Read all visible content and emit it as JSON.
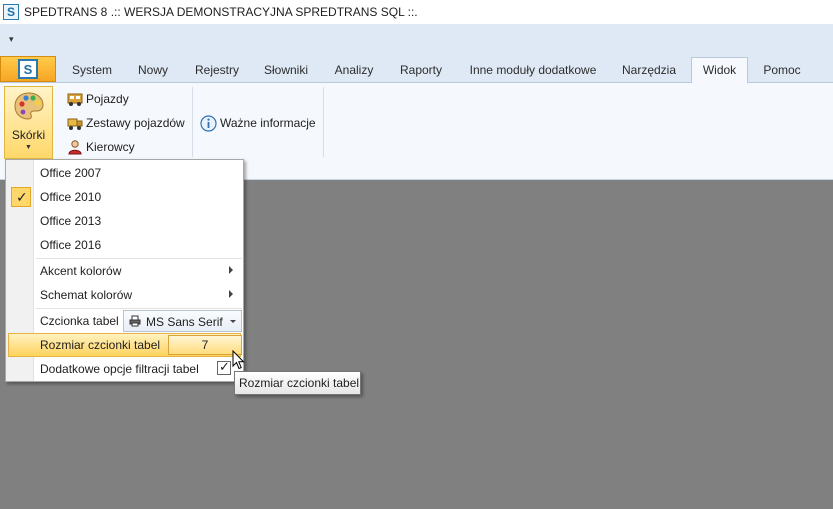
{
  "window": {
    "title": "SPEDTRANS 8 .:: WERSJA DEMONSTRACYJNA SPREDTRANS SQL ::."
  },
  "app_icon": {
    "letter": "S"
  },
  "tabs": [
    {
      "label": "System"
    },
    {
      "label": "Nowy"
    },
    {
      "label": "Rejestry"
    },
    {
      "label": "Słowniki"
    },
    {
      "label": "Analizy"
    },
    {
      "label": "Raporty"
    },
    {
      "label": "Inne moduły dodatkowe"
    },
    {
      "label": "Narzędzia"
    },
    {
      "label": "Widok",
      "active": true
    },
    {
      "label": "Pomoc"
    }
  ],
  "ribbon": {
    "skorki_label": "Skórki",
    "items": [
      {
        "label": "Pojazdy",
        "icon": "vehicle-icon"
      },
      {
        "label": "Zestawy pojazdów",
        "icon": "truck-icon"
      },
      {
        "label": "Kierowcy",
        "icon": "driver-icon"
      }
    ],
    "info_label": "Ważne informacje"
  },
  "menu": {
    "items": [
      {
        "label": "Office 2007"
      },
      {
        "label": "Office 2010",
        "checked": true
      },
      {
        "label": "Office 2013"
      },
      {
        "label": "Office 2016"
      },
      {
        "label": "Akcent kolorów"
      },
      {
        "label": "Schemat kolorów"
      },
      {
        "label": "Czcionka tabel",
        "value": "MS Sans Serif"
      },
      {
        "label": "Rozmiar czcionki tabel",
        "value": "7"
      },
      {
        "label": "Dodatkowe opcje filtracji tabel",
        "checked": true
      }
    ]
  },
  "tooltip": {
    "text": "Rozmiar czcionki tabel"
  },
  "colors": {
    "accent": "#ffd35d",
    "app_button": "#f6a623",
    "workspace": "#808080",
    "ribbon_bg": "#f5f8fc"
  }
}
